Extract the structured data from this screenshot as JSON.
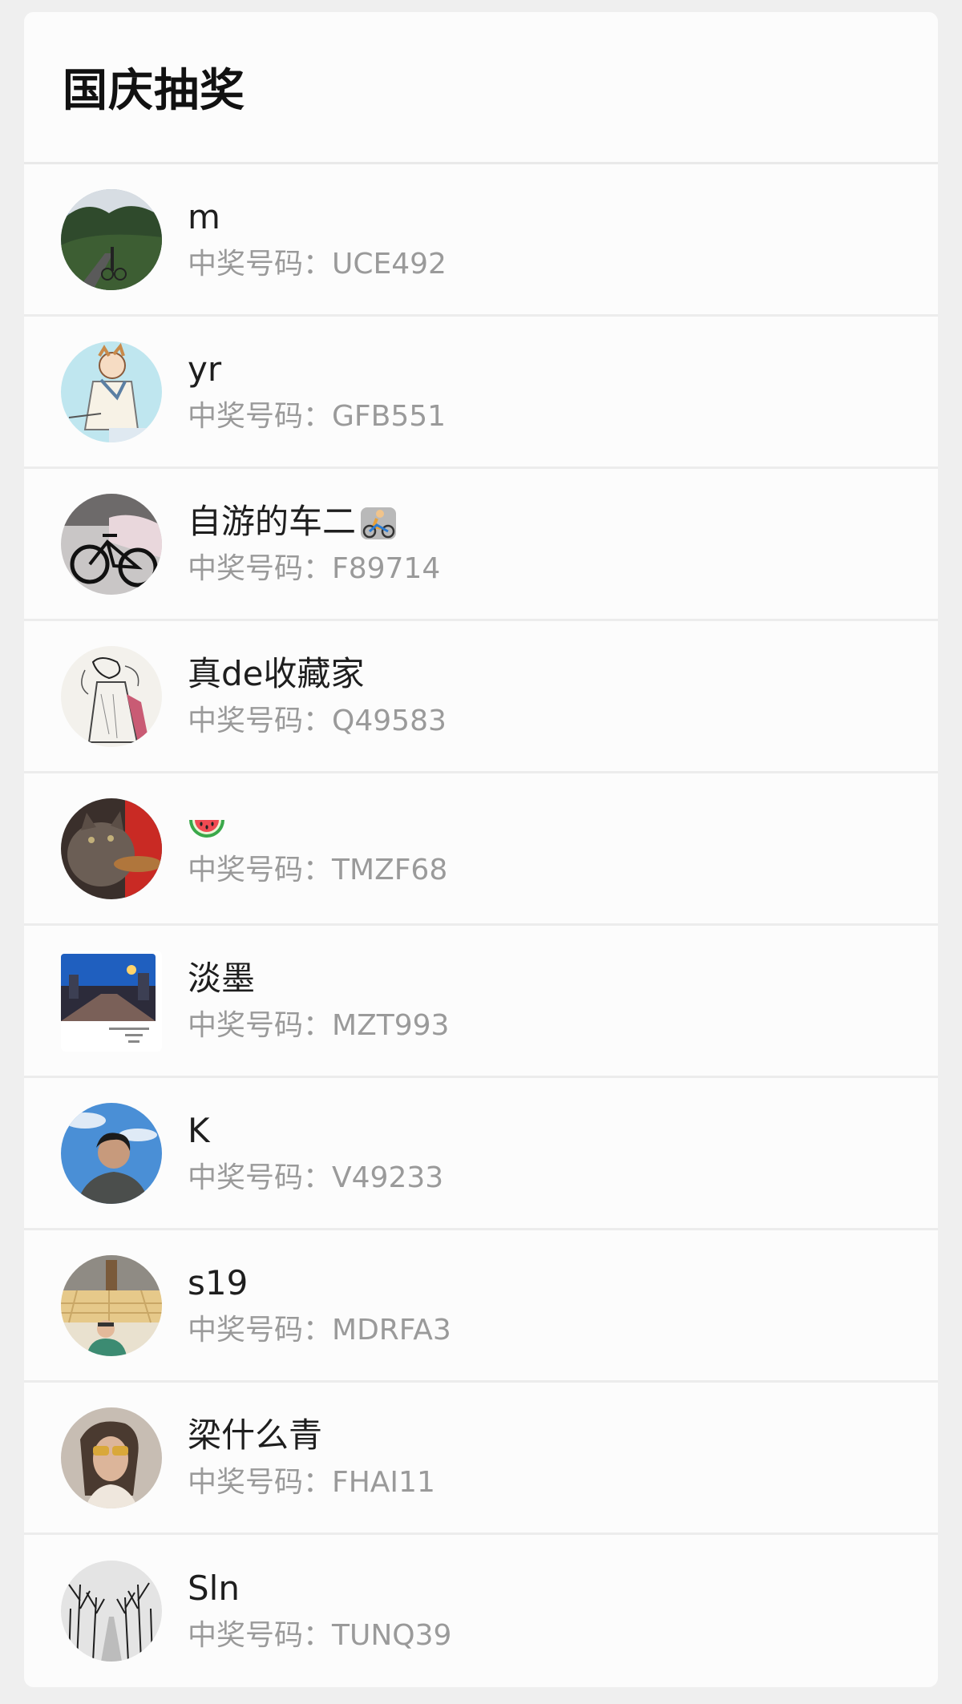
{
  "page": {
    "title": "国庆抽奖"
  },
  "winners": [
    {
      "name": "m",
      "code_label": "中奖号码：",
      "code": "UCE492",
      "avatar": "mountain-road-photo"
    },
    {
      "name": "yr",
      "code_label": "中奖号码：",
      "code": "GFB551",
      "avatar": "cartoon-boy-illustration"
    },
    {
      "name": "自游的车二",
      "name_emoji": "person-biking-emoji",
      "code_label": "中奖号码：",
      "code": "F89714",
      "avatar": "bicycle-photo"
    },
    {
      "name": "真de收藏家",
      "code_label": "中奖号码：",
      "code": "Q49583",
      "avatar": "ink-sketch-figure"
    },
    {
      "name": "",
      "name_emoji": "watermelon-emoji",
      "code_label": "中奖号码：",
      "code": "TMZF68",
      "avatar": "cat-photo"
    },
    {
      "name": "淡墨",
      "code_label": "中奖号码：",
      "code": "MZT993",
      "avatar": "city-street-photo"
    },
    {
      "name": "K",
      "code_label": "中奖号码：",
      "code": "V49233",
      "avatar": "selfie-sky-photo"
    },
    {
      "name": "s19",
      "code_label": "中奖号码：",
      "code": "MDRFA3",
      "avatar": "hall-portrait-photo"
    },
    {
      "name": "梁什么青",
      "code_label": "中奖号码：",
      "code": "FHAI11",
      "avatar": "sunglasses-portrait-photo"
    },
    {
      "name": "Sln",
      "code_label": "中奖号码：",
      "code": "TUNQ39",
      "avatar": "tree-road-bw-photo"
    }
  ],
  "colors": {
    "background": "#efefef",
    "card": "#fcfcfc",
    "name_text": "#1e1e1e",
    "code_text": "#9a9a9a"
  }
}
